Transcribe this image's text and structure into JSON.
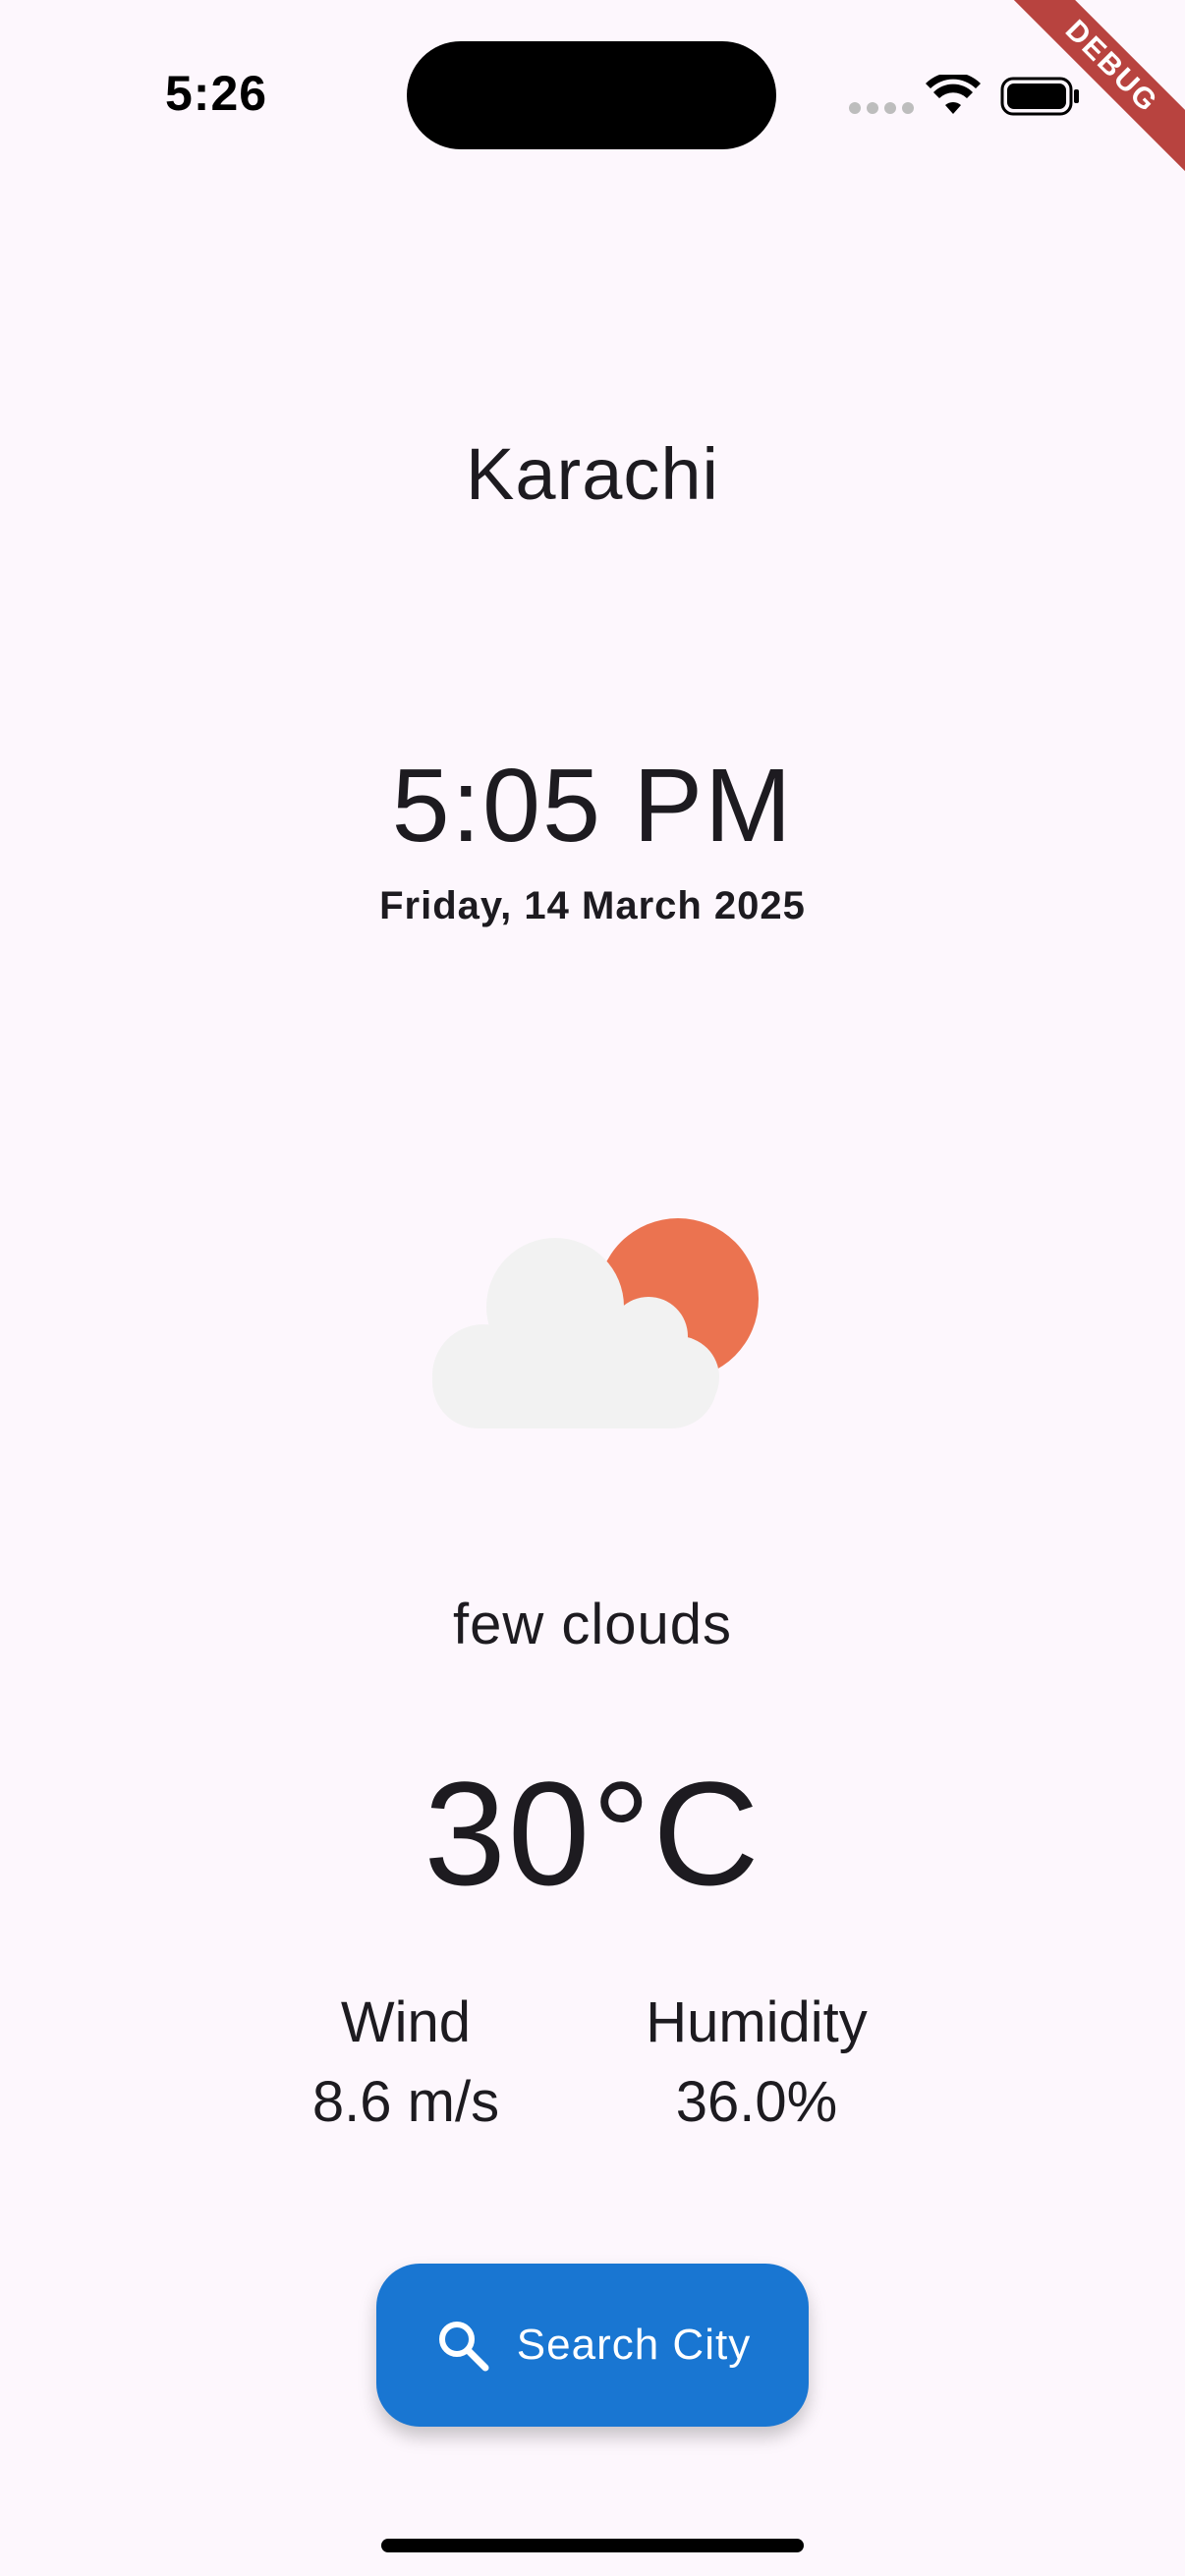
{
  "status_bar": {
    "time": "5:26",
    "debug_label": "DEBUG"
  },
  "weather": {
    "city": "Karachi",
    "local_time": "5:05 PM",
    "date": "Friday, 14 March 2025",
    "icon": "partly-cloudy-day-icon",
    "description": "few clouds",
    "temperature": "30°C"
  },
  "stats": {
    "wind": {
      "label": "Wind",
      "value": "8.6 m/s"
    },
    "humidity": {
      "label": "Humidity",
      "value": "36.0%"
    }
  },
  "actions": {
    "search_label": "Search City",
    "search_icon": "search-icon"
  },
  "colors": {
    "background": "#FDF7FD",
    "button": "#1976D2",
    "sun": "#EB7350",
    "cloud": "#F2F2F2",
    "debug_banner": "#B8433F"
  }
}
